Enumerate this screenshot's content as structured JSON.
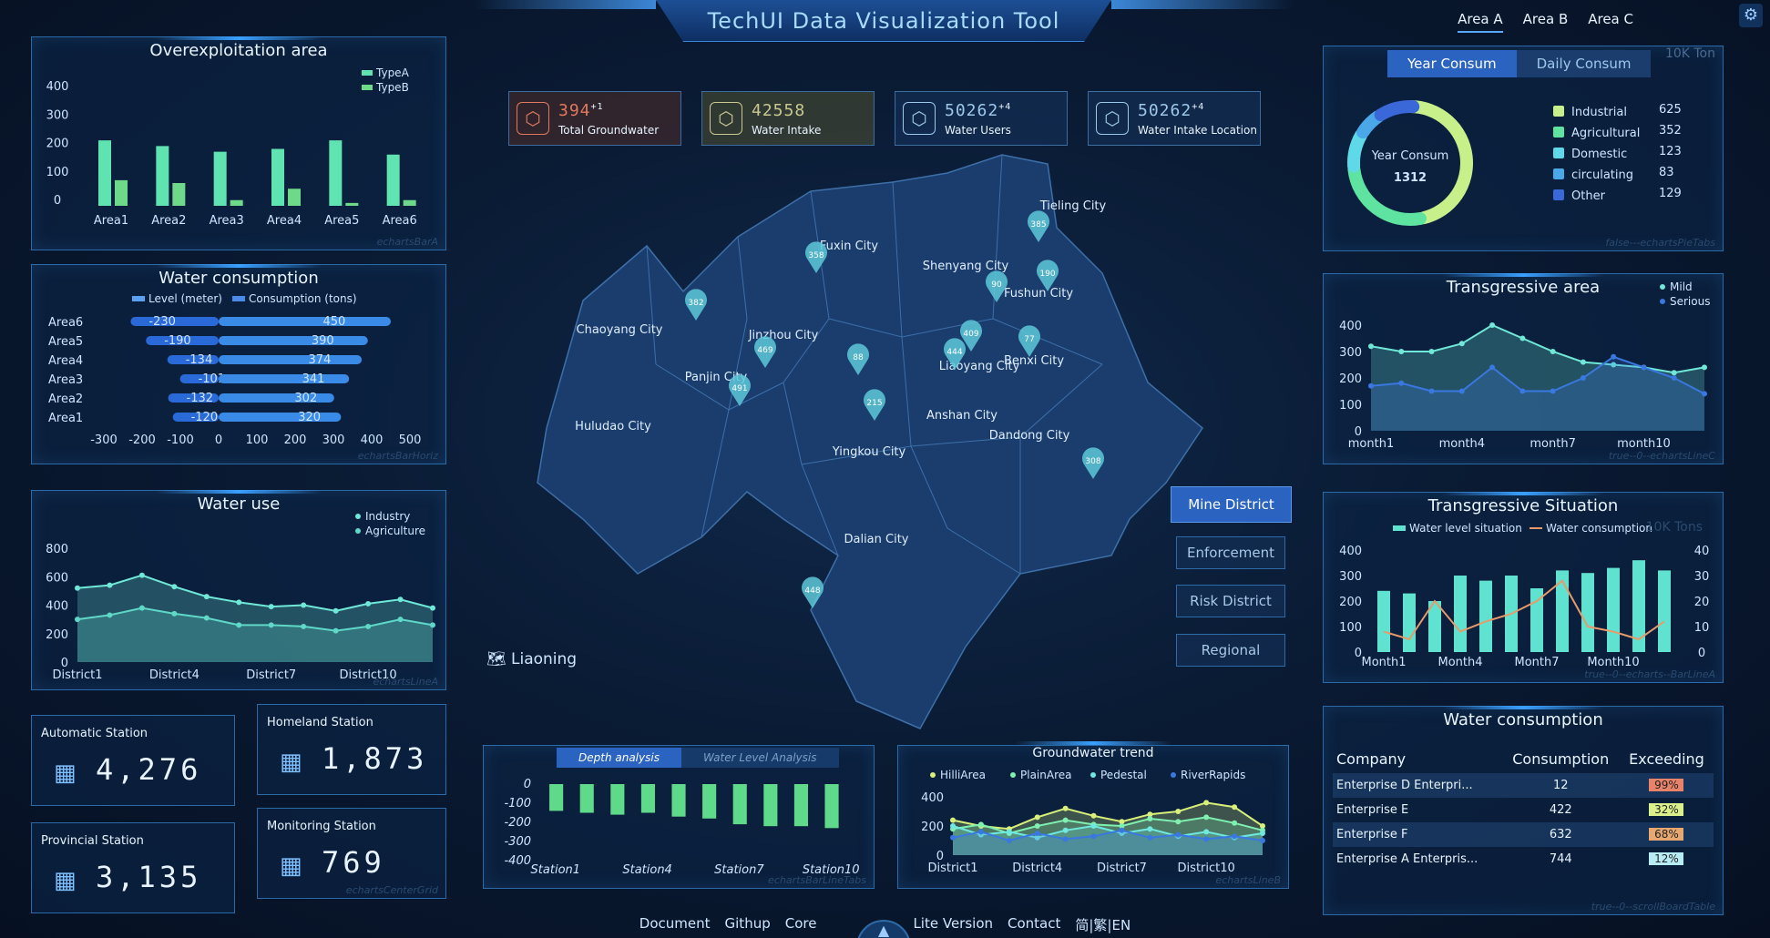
{
  "app": {
    "title": "TechUI Data Visualization Tool",
    "settings_icon": "gear-icon"
  },
  "area_tabs": [
    "Area A",
    "Area B",
    "Area C"
  ],
  "kpis": [
    {
      "value": "394",
      "delta": "+1",
      "label": "Total Groundwater",
      "color": "#e07a5f",
      "icon": "hexagon-icon"
    },
    {
      "value": "42558",
      "delta": "",
      "label": "Water Intake",
      "color": "#c8c890",
      "icon": "intake-icon"
    },
    {
      "value": "50262",
      "delta": "+4",
      "label": "Water Users",
      "color": "#9ec8ea",
      "icon": "users-icon"
    },
    {
      "value": "50262",
      "delta": "+4",
      "label": "Water Intake Location",
      "color": "#9ec8ea",
      "icon": "location-cube-icon"
    }
  ],
  "map": {
    "region_label": "Liaoning",
    "cities": [
      "Tieling City",
      "Fuxin City",
      "Shenyang City",
      "Fushun City",
      "Chaoyang City",
      "Jinzhou City",
      "Panjin City",
      "Liaoyang City",
      "Benxi City",
      "Anshan City",
      "Huludao City",
      "Dandong City",
      "Yingkou City",
      "Dalian City"
    ],
    "pins": [
      "385",
      "358",
      "190",
      "90",
      "382",
      "469",
      "409",
      "444",
      "77",
      "88",
      "491",
      "215",
      "308",
      "448"
    ],
    "buttons": [
      "Mine District",
      "Enforcement",
      "Risk District",
      "Regional"
    ]
  },
  "stations": [
    {
      "name": "Automatic Station",
      "value": "4,276"
    },
    {
      "name": "Homeland Station",
      "value": "1,873"
    },
    {
      "name": "Provincial Station",
      "value": "3,135"
    },
    {
      "name": "Monitoring Station",
      "value": "769"
    }
  ],
  "stations_watermark": "echartsCenterGrid",
  "bottom_left": {
    "tabs": [
      "Depth analysis",
      "Water Level Analysis"
    ],
    "watermark": "echartsBarLineTabs"
  },
  "bottom_right": {
    "watermark": "echartsLineB"
  },
  "table": {
    "title": "Water consumption",
    "headers": [
      "Company",
      "Consumption",
      "Exceeding"
    ],
    "rows": [
      {
        "company": "Enterprise D Enterpri...",
        "consumption": "12",
        "exceeding": "99%",
        "color": "#e8836a"
      },
      {
        "company": "Enterprise E",
        "consumption": "422",
        "exceeding": "32%",
        "color": "#d9ef8b"
      },
      {
        "company": "Enterprise F",
        "consumption": "632",
        "exceeding": "68%",
        "color": "#e6a870"
      },
      {
        "company": "Enterprise A Enterpris...",
        "consumption": "744",
        "exceeding": "12%",
        "color": "#b8ecf4"
      }
    ],
    "watermark": "true--0--scrollBoardTable"
  },
  "footer": [
    "Document",
    "Githup",
    "Core",
    "Lite Version",
    "Contact",
    "简|繁|EN"
  ],
  "chart_data": [
    {
      "id": "overexploitation",
      "type": "bar",
      "title": "Overexploitation area",
      "categories": [
        "Area1",
        "Area2",
        "Area3",
        "Area4",
        "Area5",
        "Area6"
      ],
      "series": [
        {
          "name": "TypeA",
          "values": [
            230,
            210,
            190,
            200,
            230,
            180
          ]
        },
        {
          "name": "TypeB",
          "values": [
            90,
            80,
            20,
            60,
            10,
            20
          ]
        }
      ],
      "ylim": [
        0,
        400
      ],
      "yticks": [
        "400",
        "300",
        "200",
        "100",
        "0"
      ],
      "watermark": "echartsBarA"
    },
    {
      "id": "water_consumption_h",
      "type": "bar",
      "title": "Water consumption",
      "categories": [
        "Area6",
        "Area5",
        "Area4",
        "Area3",
        "Area2",
        "Area1"
      ],
      "series": [
        {
          "name": "Level (meter)",
          "values": [
            -230,
            -190,
            -134,
            -101,
            -132,
            -120
          ]
        },
        {
          "name": "Consumption (tons)",
          "values": [
            450,
            390,
            374,
            341,
            302,
            320
          ]
        }
      ],
      "xticks": [
        "-300",
        "-200",
        "-100",
        "0",
        "100",
        "200",
        "300",
        "400",
        "500"
      ],
      "watermark": "echartsBarHoriz"
    },
    {
      "id": "water_use",
      "type": "line",
      "title": "Water use",
      "x": [
        "District1",
        "District2",
        "District3",
        "District4",
        "District5",
        "District6",
        "District7",
        "District8",
        "District9",
        "District10",
        "District11",
        "District12"
      ],
      "xticks": [
        "District1",
        "District4",
        "District7",
        "District10"
      ],
      "series": [
        {
          "name": "Industry",
          "values": [
            520,
            540,
            610,
            530,
            460,
            420,
            390,
            400,
            360,
            410,
            440,
            380
          ]
        },
        {
          "name": "Agriculture",
          "values": [
            300,
            330,
            380,
            340,
            310,
            260,
            260,
            250,
            220,
            250,
            300,
            260
          ]
        }
      ],
      "ylim": [
        0,
        800
      ],
      "yticks": [
        "800",
        "600",
        "400",
        "200",
        "0"
      ],
      "watermark": "echartsLineA"
    },
    {
      "id": "donut",
      "type": "pie",
      "tabs": [
        "Year Consum",
        "Daily Consum"
      ],
      "unit": "10K Ton",
      "center_label": "Year Consum",
      "center_value": "1312",
      "slices": [
        {
          "name": "Industrial",
          "value": 625,
          "color": "#c8f08a"
        },
        {
          "name": "Agricultural",
          "value": 352,
          "color": "#5ee3a0"
        },
        {
          "name": "Domestic",
          "value": 123,
          "color": "#5fd8e8"
        },
        {
          "name": "circulating",
          "value": 83,
          "color": "#4aa8e8"
        },
        {
          "name": "Other",
          "value": 129,
          "color": "#3a68d8"
        }
      ],
      "watermark": "false---echartsPieTabs"
    },
    {
      "id": "transgressive_area",
      "type": "line",
      "title": "Transgressive area",
      "x": [
        "month1",
        "month2",
        "month3",
        "month4",
        "month5",
        "month6",
        "month7",
        "month8",
        "month9",
        "month10",
        "month11",
        "month12"
      ],
      "xticks": [
        "month1",
        "month4",
        "month7",
        "month10"
      ],
      "series": [
        {
          "name": "Mild",
          "values": [
            320,
            300,
            300,
            330,
            400,
            350,
            300,
            260,
            250,
            240,
            220,
            240
          ]
        },
        {
          "name": "Serious",
          "values": [
            170,
            180,
            150,
            150,
            240,
            150,
            150,
            200,
            280,
            240,
            200,
            140
          ]
        }
      ],
      "ylim": [
        0,
        400
      ],
      "yticks": [
        "400",
        "300",
        "200",
        "100",
        "0"
      ],
      "watermark": "true--0--echartsLineC"
    },
    {
      "id": "transgressive_situation",
      "type": "bar",
      "title": "Transgressive Situation",
      "unit": "10K Tons",
      "x": [
        "Month1",
        "Month2",
        "Month3",
        "Month4",
        "Month5",
        "Month6",
        "Month7",
        "Month8",
        "Month9",
        "Month10",
        "Month11",
        "Month12"
      ],
      "xticks": [
        "Month1",
        "Month4",
        "Month7",
        "Month10"
      ],
      "series": [
        {
          "name": "Water level situation",
          "values": [
            240,
            230,
            200,
            300,
            280,
            300,
            250,
            320,
            310,
            330,
            360,
            320
          ]
        },
        {
          "name": "Water consumption",
          "values": [
            8,
            5,
            20,
            8,
            12,
            15,
            20,
            28,
            10,
            8,
            5,
            12
          ]
        }
      ],
      "ylim": [
        0,
        400
      ],
      "yticks": [
        "400",
        "300",
        "200",
        "100",
        "0"
      ],
      "y2ticks": [
        "40",
        "30",
        "20",
        "10",
        "0"
      ],
      "watermark": "true--0--echarts--BarLineA"
    },
    {
      "id": "depth_analysis",
      "type": "bar",
      "categories": [
        "Station1",
        "Station2",
        "Station3",
        "Station4",
        "Station5",
        "Station6",
        "Station7",
        "Station8",
        "Station9",
        "Station10"
      ],
      "xticks": [
        "Station1",
        "Station4",
        "Station7",
        "Station10"
      ],
      "values": [
        -140,
        -150,
        -160,
        -150,
        -170,
        -180,
        -210,
        -220,
        -220,
        -230
      ],
      "ylim": [
        -400,
        0
      ],
      "yticks": [
        "0",
        "-100",
        "-200",
        "-300",
        "-400"
      ]
    },
    {
      "id": "groundwater_trend",
      "type": "area",
      "title": "Groundwater trend",
      "x": [
        "District1",
        "District2",
        "District3",
        "District4",
        "District5",
        "District6",
        "District7",
        "District8",
        "District9",
        "District10",
        "District11",
        "District12"
      ],
      "xticks": [
        "District1",
        "District4",
        "District7",
        "District10"
      ],
      "series": [
        {
          "name": "HilliArea",
          "values": [
            240,
            200,
            180,
            260,
            320,
            270,
            230,
            280,
            300,
            360,
            330,
            200
          ]
        },
        {
          "name": "PlainArea",
          "values": [
            180,
            210,
            150,
            200,
            240,
            210,
            200,
            250,
            230,
            260,
            220,
            170
          ]
        },
        {
          "name": "Pedestal",
          "values": [
            200,
            140,
            160,
            120,
            170,
            200,
            150,
            180,
            130,
            160,
            120,
            150
          ]
        },
        {
          "name": "RiverRapids",
          "values": [
            120,
            160,
            100,
            150,
            110,
            130,
            170,
            120,
            140,
            110,
            130,
            100
          ]
        }
      ],
      "ylim": [
        0,
        400
      ],
      "yticks": [
        "400",
        "200",
        "0"
      ]
    }
  ]
}
